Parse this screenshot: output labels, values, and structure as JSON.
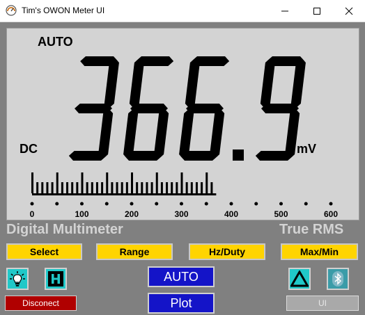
{
  "window": {
    "title": "Tim's OWON Meter UI",
    "controls": [
      "minimize-icon",
      "maximize-icon",
      "close-icon"
    ]
  },
  "display": {
    "range_mode": "AUTO",
    "coupling": "DC",
    "reading": "366.9",
    "unit": "mV",
    "bargraph": {
      "scale_labels": [
        "0",
        "100",
        "200",
        "300",
        "400",
        "500",
        "600"
      ],
      "level": 366.9,
      "max": 600
    },
    "colors": {
      "lcd_bg": "#d3d3d3",
      "segment": "#000000"
    }
  },
  "banner": {
    "left": "Digital Multimeter",
    "right": "True RMS"
  },
  "buttons": {
    "select": "Select",
    "range": "Range",
    "hz_duty": "Hz/Duty",
    "max_min": "Max/Min",
    "auto": "AUTO",
    "plot": "Plot",
    "disconnect": "Disconect",
    "ui": "UI"
  },
  "icons": {
    "backlight": "lightbulb-icon",
    "hold": "hold-h-icon",
    "relative": "delta-triangle-icon",
    "bluetooth": "bluetooth-icon"
  },
  "colors": {
    "function_button": "#ffd400",
    "icon_button": "#20c8c8",
    "blue_button": "#1414c8",
    "disconnect_button": "#b00000"
  }
}
